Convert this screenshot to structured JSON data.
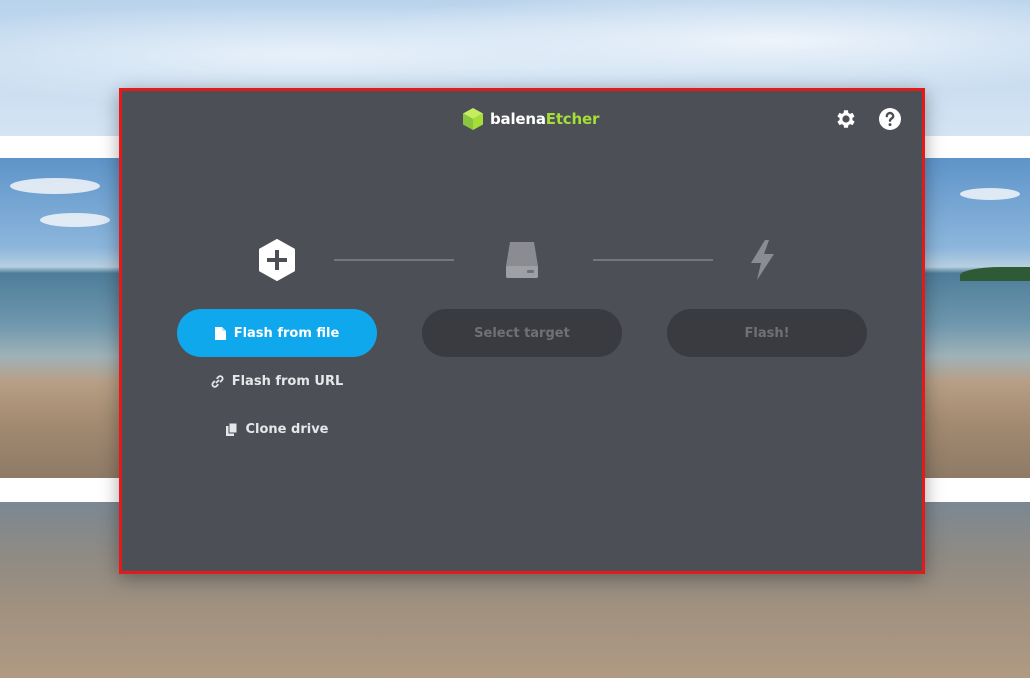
{
  "app": {
    "brand_part1": "balena",
    "brand_part2": "Etcher",
    "brand_color": "#a5de37",
    "accent_color": "#10a8ec",
    "window_bg": "#4d4f56"
  },
  "toolbar": {
    "settings_icon": "gear-icon",
    "help_icon": "question-icon"
  },
  "steps": {
    "source": {
      "icon": "hexagon-plus-icon",
      "primary_label": "Flash from file",
      "primary_icon": "file-icon",
      "url_label": "Flash from URL",
      "url_icon": "link-icon",
      "clone_label": "Clone drive",
      "clone_icon": "copy-icon"
    },
    "target": {
      "icon": "drive-icon",
      "label": "Select target"
    },
    "flash": {
      "icon": "lightning-icon",
      "label": "Flash!"
    }
  }
}
